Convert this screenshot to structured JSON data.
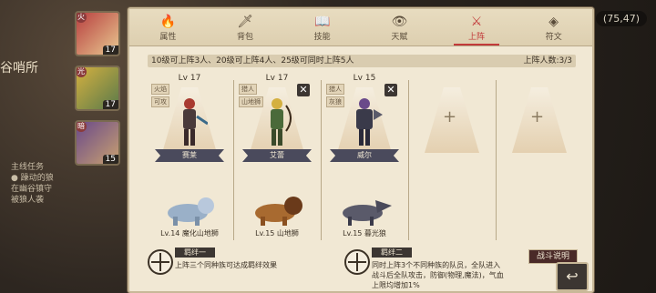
{
  "background": {
    "location_text": "谷哨所",
    "info_lines": [
      "主线任务",
      "● 躁动的狼",
      "  在幽谷镇守",
      "  被狼人袭"
    ]
  },
  "coords": "(75,47)",
  "roster": [
    {
      "level": "17",
      "badge": "火",
      "color": "#b84040"
    },
    {
      "level": "17",
      "badge": "光",
      "color": "#d4b040"
    },
    {
      "level": "15",
      "badge": "暗",
      "color": "#6a4a8a"
    }
  ],
  "tabs": [
    {
      "label": "属性",
      "icon": "🔥",
      "active": false
    },
    {
      "label": "背包",
      "icon": "🗡",
      "active": false
    },
    {
      "label": "技能",
      "icon": "📖",
      "active": false
    },
    {
      "label": "天赋",
      "icon": "👁",
      "active": false
    },
    {
      "label": "上阵",
      "icon": "⚔",
      "active": true
    },
    {
      "label": "符文",
      "icon": "◈",
      "active": false
    }
  ],
  "infobar": {
    "rule": "10级可上阵3人、20级可上阵4人、25级可同时上阵5人",
    "count": "上阵人数:3/3"
  },
  "heroes": [
    {
      "level": "Lv 17",
      "tags": [
        "火焰",
        "可攻"
      ],
      "name": "赛莱",
      "beast": "Lv.14 魔化山地狮",
      "hero_color": "#a83a30",
      "beast_color": "#9ab0c8",
      "removable": false
    },
    {
      "level": "Lv 17",
      "tags": [
        "猎人",
        "山地狮"
      ],
      "name": "艾蕾",
      "beast": "Lv.15 山地狮",
      "hero_color": "#4a6a3a",
      "beast_color": "#8a5a30",
      "removable": true
    },
    {
      "level": "Lv 15",
      "tags": [
        "猎人",
        "灰狼"
      ],
      "name": "威尔",
      "beast": "Lv.15 暮光狼",
      "hero_color": "#3a3a4a",
      "beast_color": "#5a5a6a",
      "removable": true
    }
  ],
  "empty_slot_icon": "+",
  "bonds": [
    {
      "title": "羁绊一",
      "text": [
        "上阵三个同种族可达成羁绊效果"
      ]
    },
    {
      "title": "羁绊二",
      "text": [
        "同时上阵3个不同种族的队员，全队进入",
        "战斗后全队攻击，防御(物理,魔法)，气血",
        "上限均增加1%"
      ]
    }
  ],
  "battle_button": "战斗说明",
  "back_icon": "↩"
}
